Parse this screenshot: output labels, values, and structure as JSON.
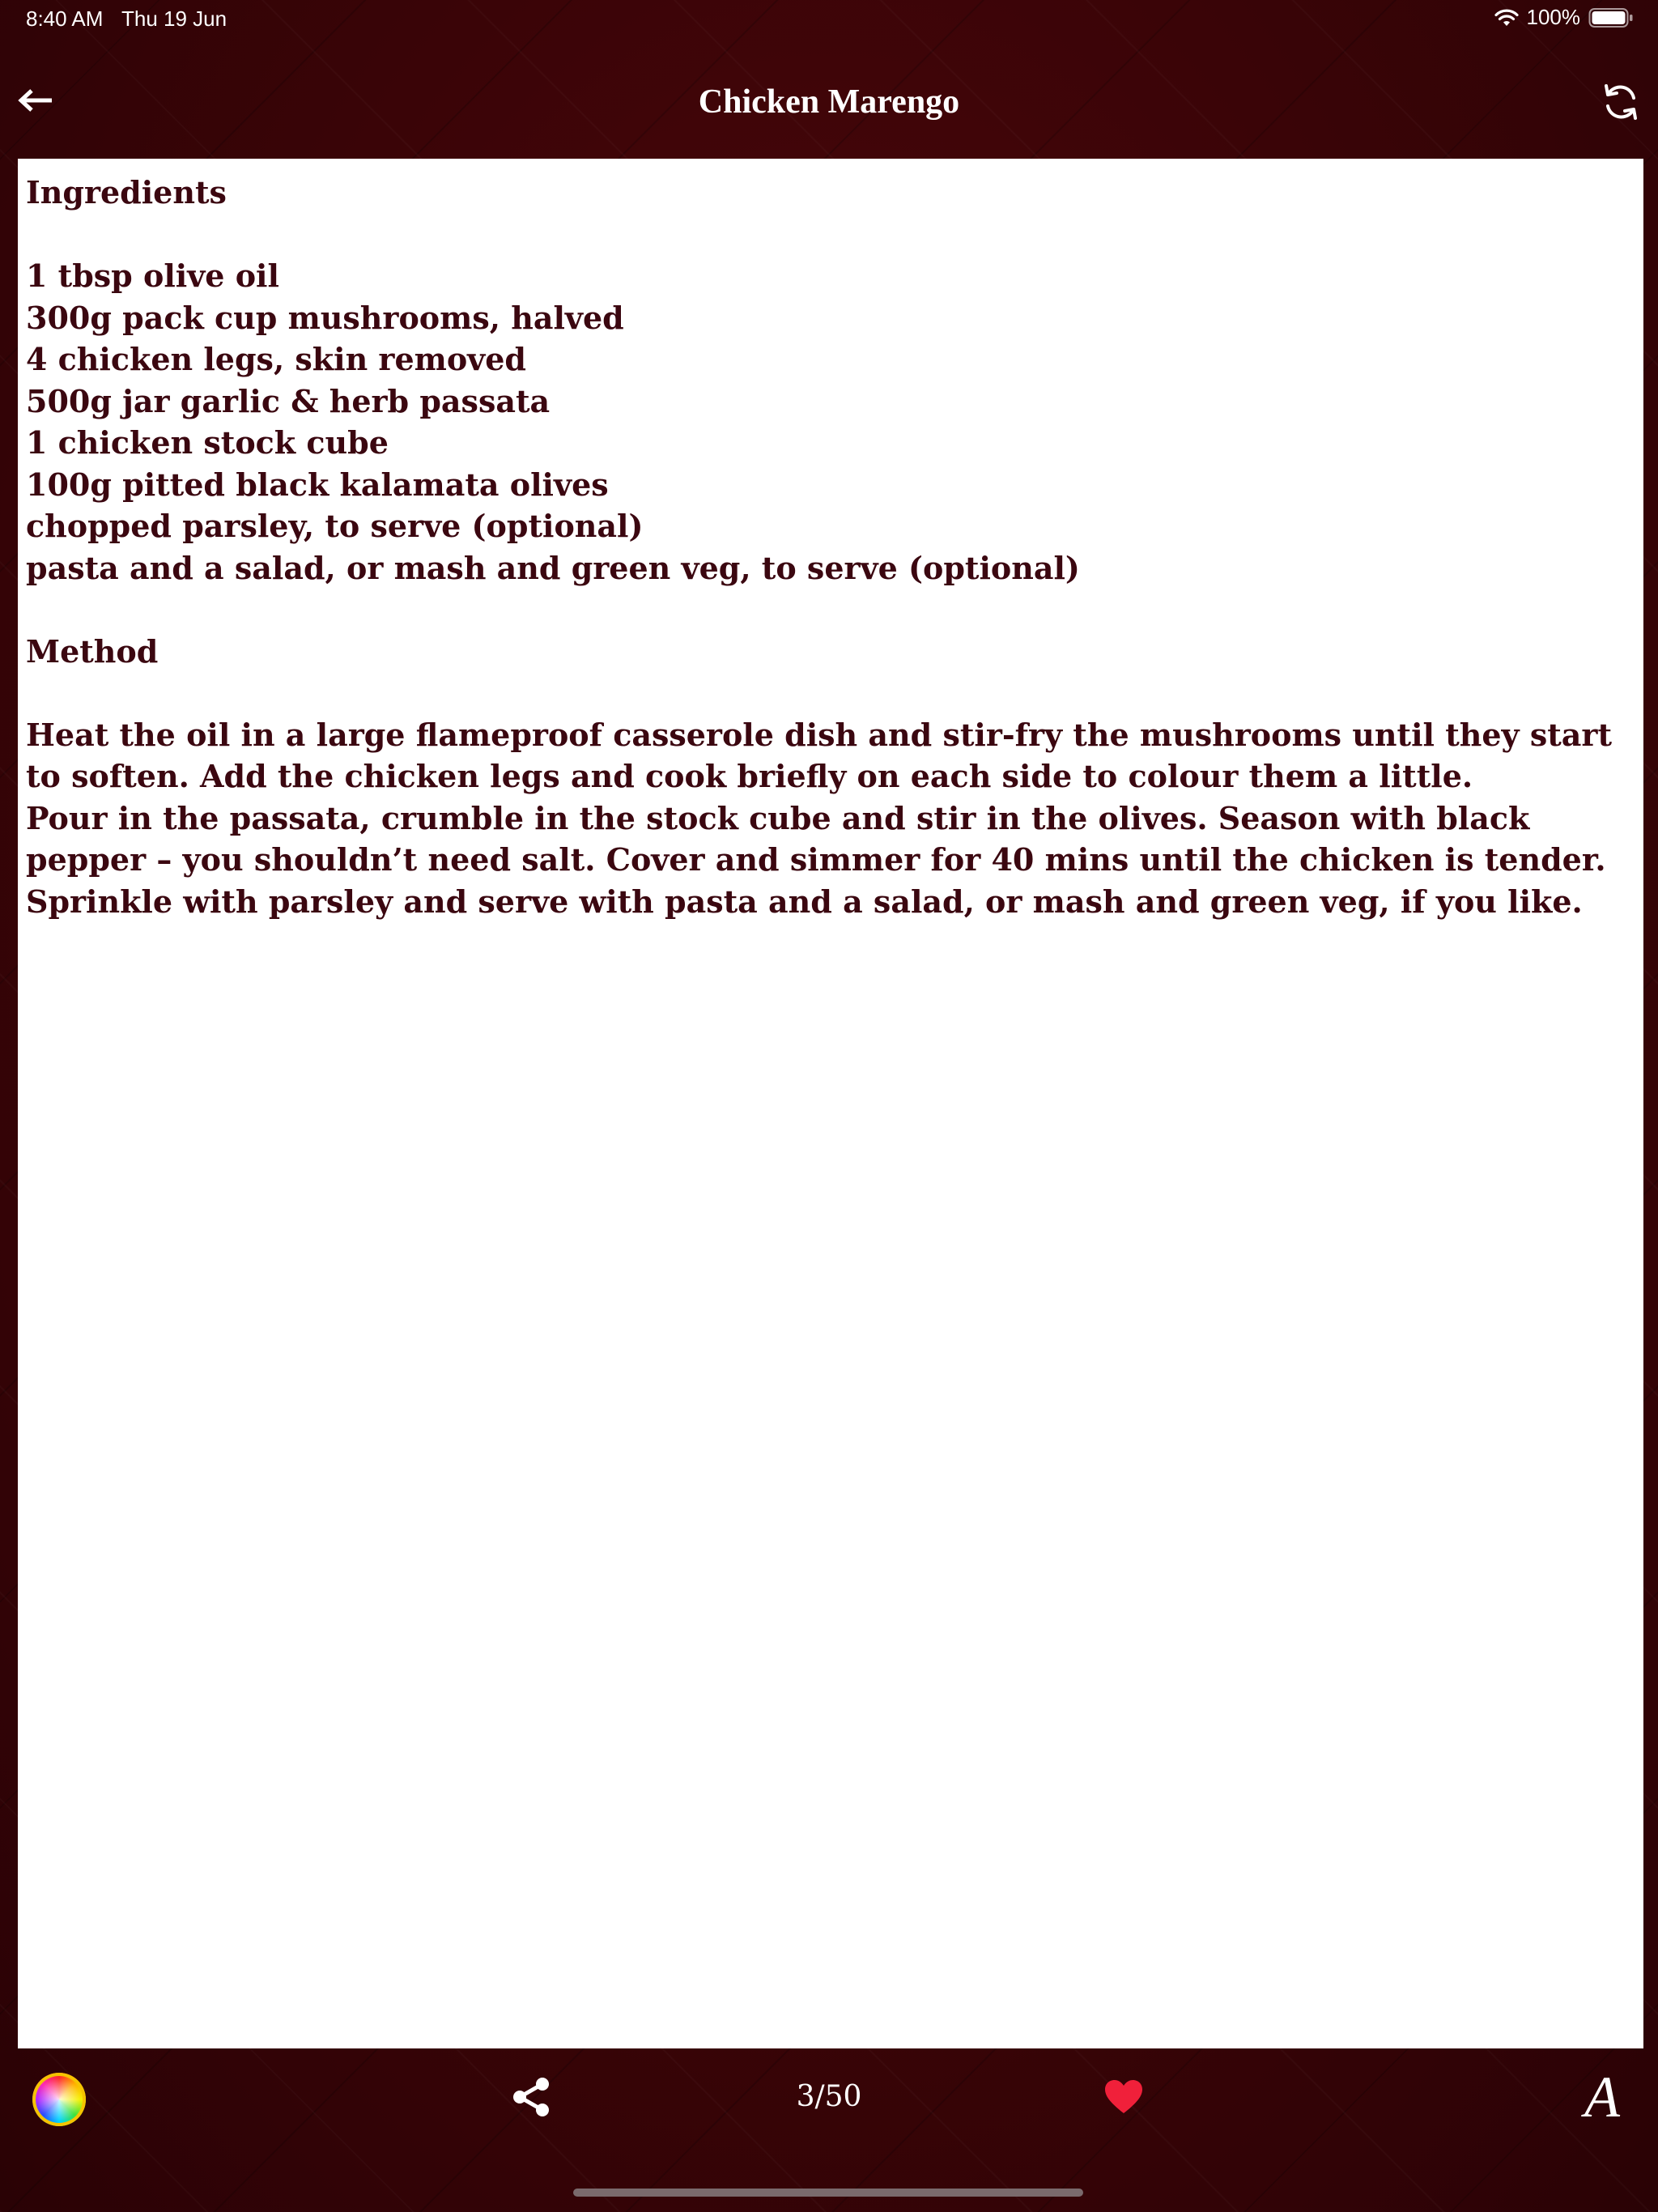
{
  "status_bar": {
    "time": "8:40 AM",
    "date": "Thu 19 Jun",
    "battery": "100%",
    "battery_level": 1.0,
    "icons": [
      "wifi-icon",
      "battery-icon"
    ]
  },
  "nav": {
    "title": "Chicken Marengo",
    "back_icon": "arrow-left-icon",
    "refresh_icon": "refresh-icon"
  },
  "recipe": {
    "ingredients_heading": "Ingredients",
    "ingredients": [
      "1 tbsp olive oil",
      "300g pack cup mushrooms, halved",
      "4 chicken legs, skin removed",
      "500g jar garlic & herb passata",
      "1 chicken stock cube",
      "100g pitted black kalamata olives",
      "chopped parsley, to serve (optional)",
      "pasta and a salad, or mash and green veg, to serve (optional)"
    ],
    "method_heading": "Method",
    "method": [
      "Heat the oil in a large flameproof casserole dish and stir-fry the mushrooms until they start to soften. Add the chicken legs and cook briefly on each side to colour them a little.",
      "Pour in the passata, crumble in the stock cube and stir in the olives. Season with black pepper – you shouldn’t need salt. Cover and simmer for 40 mins until the chicken is tender. Sprinkle with parsley and serve with pasta and a salad, or mash and green veg, if you like."
    ]
  },
  "toolbar": {
    "page_counter": "3/50",
    "font_label": "A",
    "icons": [
      "color-wheel-icon",
      "share-icon",
      "heart-icon",
      "font-icon"
    ]
  },
  "colors": {
    "background": "#3a0407",
    "text": "#3b0710",
    "heart": "#f0203a"
  }
}
